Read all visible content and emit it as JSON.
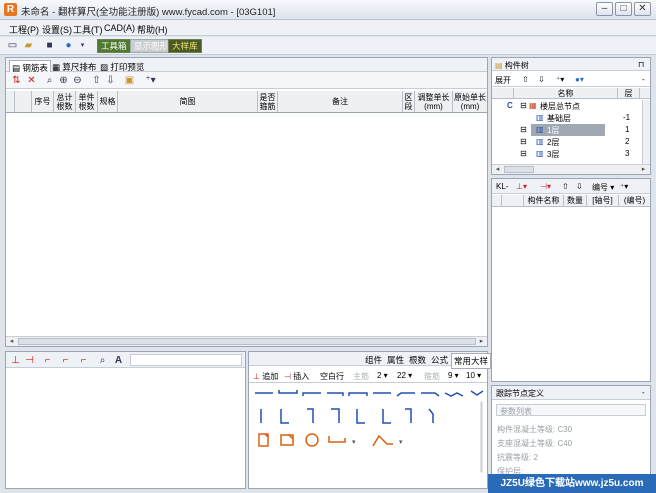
{
  "title": "未命名 - 翻样算尺(全功能注册版) www.fycad.com - [03G101]",
  "menu": [
    "工程(P)",
    "设置(S)",
    "工具(T)",
    "CAD(A)",
    "帮助(H)"
  ],
  "toolbar": {
    "tool_box": "工具箱",
    "show_drawing": "显示图形",
    "big_sample": "大样库"
  },
  "left_tabs": [
    "钢筋表",
    "算尺排布",
    "打印预览"
  ],
  "columns": [
    "序号",
    "总计根数",
    "单件根数",
    "规格",
    "简图",
    "是否箍筋",
    "备注",
    "区段",
    "调整单长(mm)",
    "原始单长(mm)"
  ],
  "palette_tabs": [
    "组件",
    "属性",
    "根数",
    "公式",
    "常用大样"
  ],
  "palette_toolbar": {
    "add": "追加",
    "insert": "插入",
    "space_row": "空白行",
    "main_rebar": "主筋",
    "n1": "2",
    "n2": "22",
    "stirrup": "箍筋",
    "n3": "9",
    "n4": "10"
  },
  "tree_panel": {
    "title": "构件树",
    "expand": "展开",
    "name_header": "名称",
    "floor_header": "层",
    "nodes": [
      {
        "name": "楼层总节点",
        "floor": ""
      },
      {
        "name": "基础层",
        "floor": "-1"
      },
      {
        "name": "1层",
        "floor": "1"
      },
      {
        "name": "2层",
        "floor": "2"
      },
      {
        "name": "3层",
        "floor": "3"
      }
    ],
    "root_mark": "C"
  },
  "component_panel": {
    "kl_label": "KL-",
    "sort_label": "编号",
    "headers": [
      "构件名称",
      "数量",
      "[轴号]",
      "(编号)"
    ]
  },
  "joint_panel": {
    "title": "跟踪节点定义",
    "param_list": "参数列表",
    "props": [
      "构件混凝土等级: C30",
      "支座混凝土等级: C40",
      "抗震等级: 2",
      "保护层: "
    ]
  },
  "watermark": "JZ5U绿色下载站www.jz5u.com",
  "colors": {
    "accent": "#e87722",
    "select": "#a0a8b4",
    "icon_blue": "#2450b0"
  }
}
